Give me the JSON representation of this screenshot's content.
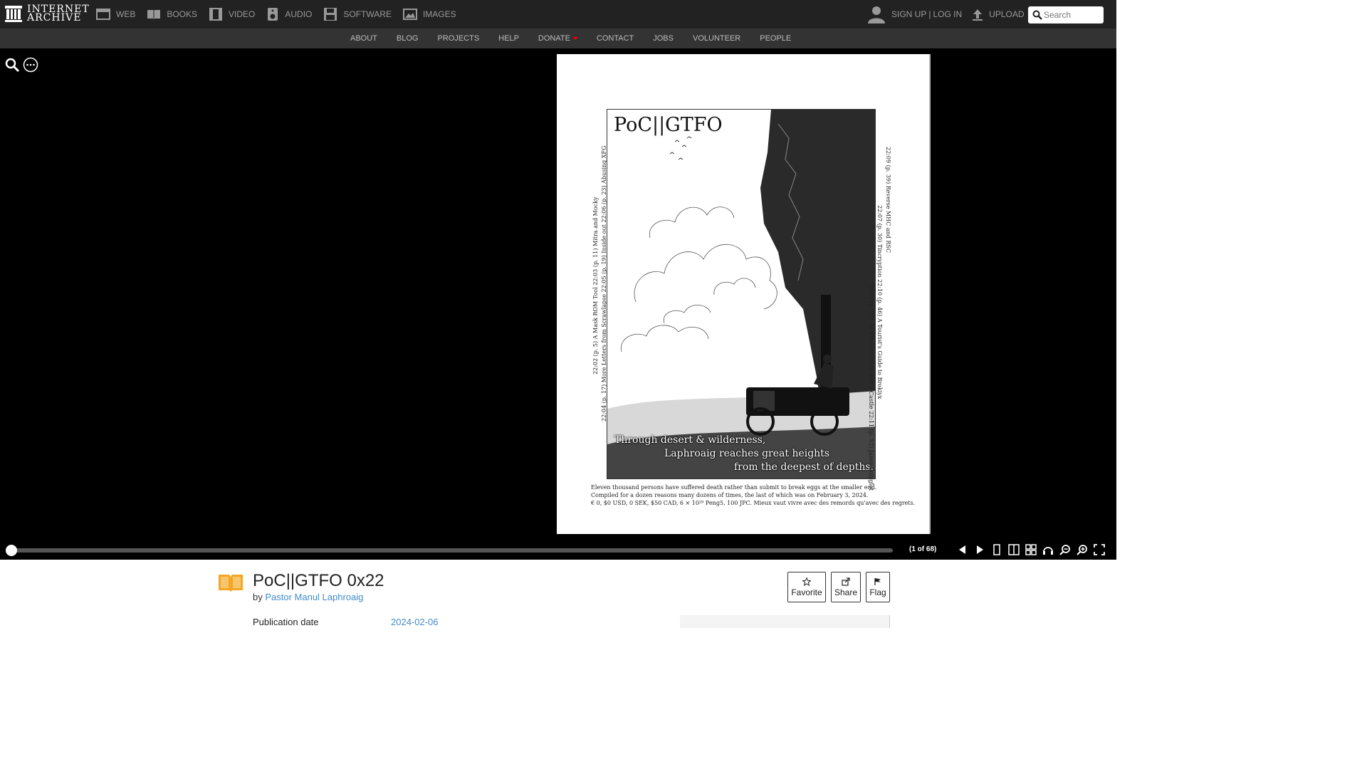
{
  "topnav": {
    "logo_line1": "INTERNET",
    "logo_line2": "ARCHIVE",
    "media": [
      {
        "label": "WEB",
        "icon": "web-icon"
      },
      {
        "label": "BOOKS",
        "icon": "books-icon"
      },
      {
        "label": "VIDEO",
        "icon": "video-icon"
      },
      {
        "label": "AUDIO",
        "icon": "audio-icon"
      },
      {
        "label": "SOFTWARE",
        "icon": "software-icon"
      },
      {
        "label": "IMAGES",
        "icon": "images-icon"
      }
    ],
    "signup": "SIGN UP",
    "separator": "|",
    "login": "LOG IN",
    "upload": "UPLOAD",
    "search_placeholder": "Search"
  },
  "subnav": {
    "items": [
      "ABOUT",
      "BLOG",
      "PROJECTS",
      "HELP",
      "DONATE",
      "CONTACT",
      "JOBS",
      "VOLUNTEER",
      "PEOPLE"
    ],
    "donate_heart": "♥"
  },
  "reader": {
    "cover_title": "PoC||GTFO",
    "caption_line1": "Through desert & wilderness,",
    "caption_line2": "Laphroaig reaches great heights",
    "caption_line3": "from the deepest of depths.",
    "left_col1": "22:02 (p. 5) A Mask ROM Tool   22:03 (p. 11) Mitra and Mocky",
    "left_col2": "22:04 (p. 17) More Letters from Scrawlapse   22:05 (p. 19) Inside out   22:06 (p. 23) Abusing XFG",
    "right_col1": "22:09 (p. 39) Reverse MHC and RSC",
    "right_col2": "22:07 (p. 30) Tincryption   22:10 (p. 46) A Tourist's Guide to Brokiyx",
    "right_col3": "22:08 (p. 37) An Showyramma and a Castle   22:11 (p. 52) Jason Polyglot",
    "footer1": "Eleven thousand persons have suffered death rather than submit to break eggs at the smaller end.",
    "footer2": "Compiled for a dozen reasons many dozens of times, the last of which was on February 3, 2024.",
    "footer3": "€ 0, $0 USD, 0 SEK, $50 CAD, 6 × 10²⁹ Peng5, 100 JPC. Mieux vaut vivre avec des remords qu'avec des regrets.",
    "page_count": "(1 of 68)",
    "progress": 0.0
  },
  "item": {
    "title": "PoC||GTFO 0x22",
    "by": "by",
    "author": "Pastor Manul Laphroaig",
    "pubdate_label": "Publication date",
    "pubdate_value": "2024-02-06",
    "favorite": "Favorite",
    "share": "Share",
    "flag": "Flag"
  },
  "colors": {
    "topbar": "#222222",
    "subbar": "#333333",
    "link": "#428bca",
    "book_icon": "#f5a623"
  }
}
